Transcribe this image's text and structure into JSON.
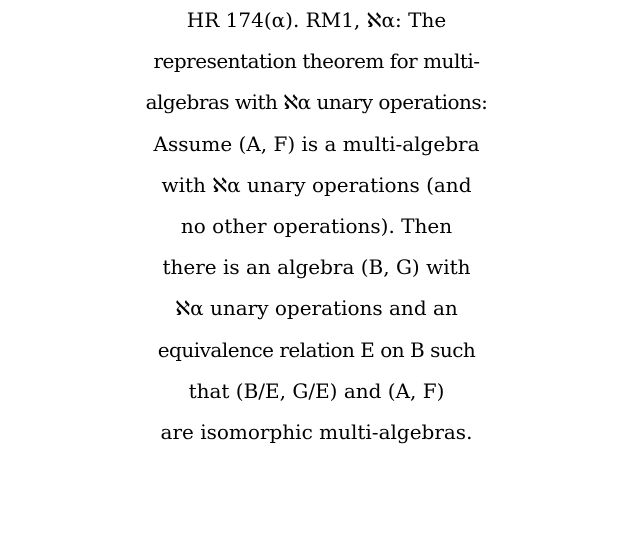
{
  "document": {
    "lines": [
      "HR 174(α).  RM1, ℵα:  The",
      "representation theorem for multi-",
      "algebras with ℵα unary operations:",
      "Assume (A, F) is a multi-algebra",
      "with ℵα unary operations (and",
      "no other operations).  Then",
      "there is an algebra (B, G) with",
      "ℵα unary operations and an",
      "equivalence relation E on B such",
      "that (B/E, G/E) and (A, F)",
      "are isomorphic multi-algebras."
    ]
  }
}
